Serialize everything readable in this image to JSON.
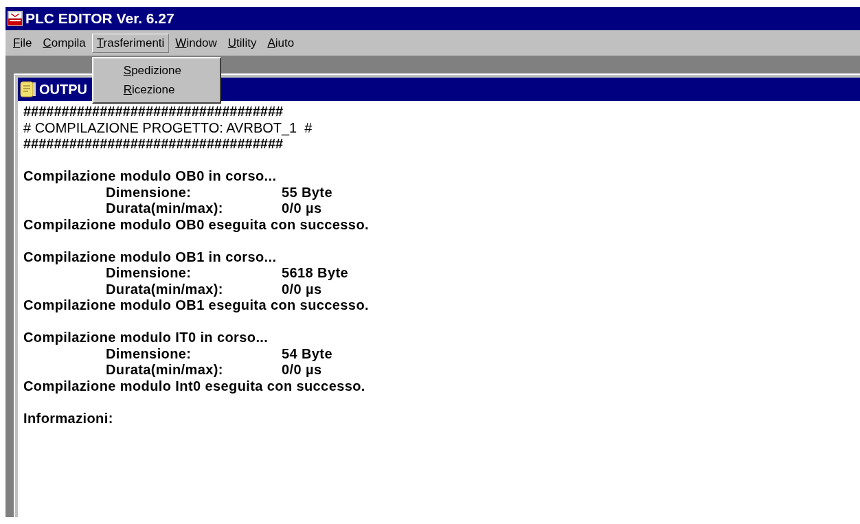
{
  "window": {
    "title": "PLC EDITOR Ver. 6.27"
  },
  "menu": [
    {
      "label": "File",
      "selected": false
    },
    {
      "label": "Compila",
      "selected": false
    },
    {
      "label": "Trasferimenti",
      "selected": true
    },
    {
      "label": "Window",
      "selected": false
    },
    {
      "label": "Utility",
      "selected": false
    },
    {
      "label": "Aiuto",
      "selected": false
    }
  ],
  "dropdown": [
    "Spedizione",
    "Ricezione"
  ],
  "child_window": {
    "title": "OUTPU"
  },
  "output": {
    "header": [
      "##################################",
      "# COMPILAZIONE PROGETTO: AVRBOT_1  #",
      "##################################"
    ],
    "sections": [
      {
        "lines": [
          {
            "kind": "text",
            "text": "Compilazione modulo OB0 in corso..."
          },
          {
            "kind": "detail",
            "label": "Dimensione:",
            "value": "55 Byte"
          },
          {
            "kind": "detail",
            "label": "Durata(min/max):",
            "value": "0/0 µs"
          },
          {
            "kind": "text",
            "text": "Compilazione modulo OB0 eseguita con successo."
          }
        ]
      },
      {
        "lines": [
          {
            "kind": "text",
            "text": "Compilazione modulo OB1 in corso..."
          },
          {
            "kind": "detail",
            "label": "Dimensione:",
            "value": "5618 Byte"
          },
          {
            "kind": "detail",
            "label": "Durata(min/max):",
            "value": "0/0 µs"
          },
          {
            "kind": "text",
            "text": "Compilazione modulo OB1 eseguita con successo."
          }
        ]
      },
      {
        "lines": [
          {
            "kind": "text",
            "text": "Compilazione modulo IT0 in corso..."
          },
          {
            "kind": "detail",
            "label": "Dimensione:",
            "value": "54 Byte"
          },
          {
            "kind": "detail",
            "label": "Durata(min/max):",
            "value": "0/0 µs"
          },
          {
            "kind": "text",
            "text": "Compilazione modulo Int0 eseguita con successo."
          }
        ]
      },
      {
        "lines": [
          {
            "kind": "text",
            "text": "Informazioni:"
          }
        ]
      }
    ]
  }
}
